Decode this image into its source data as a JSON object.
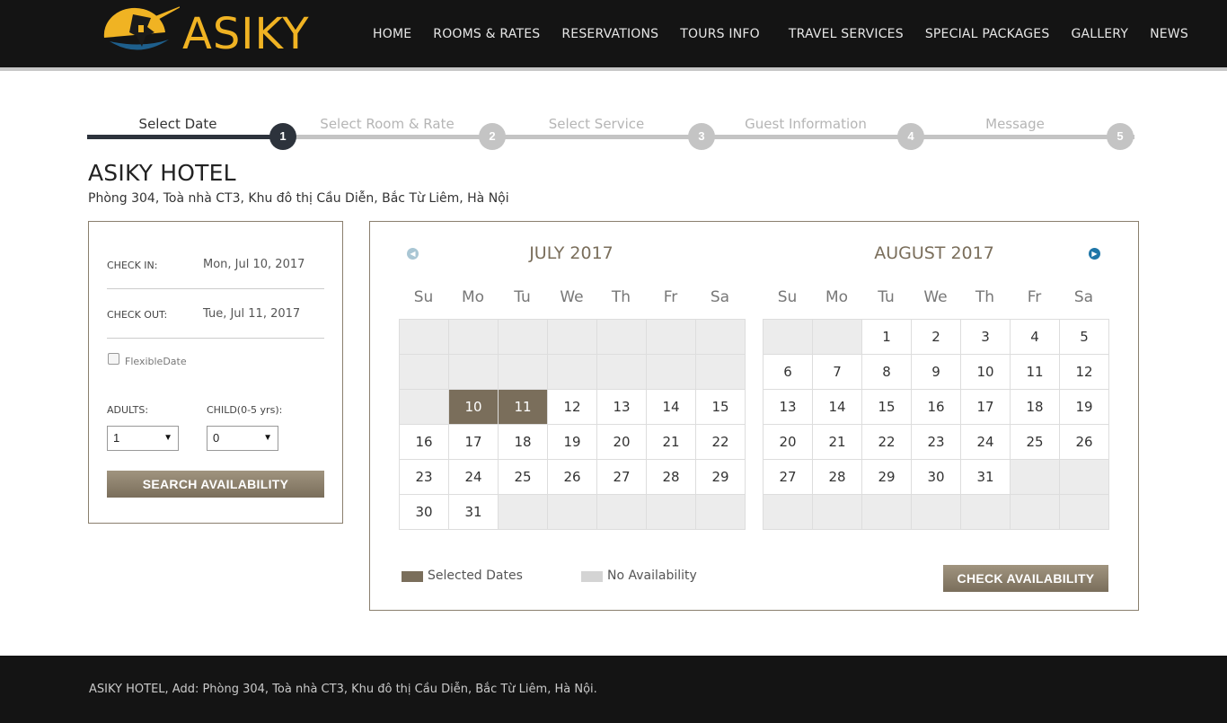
{
  "header": {
    "logo_text": "ASIKY",
    "nav": [
      "HOME",
      "ROOMS & RATES",
      "RESERVATIONS",
      "TOURS INFO",
      "TRAVEL SERVICES",
      "SPECIAL PACKAGES",
      "GALLERY",
      "NEWS"
    ]
  },
  "steps": [
    {
      "label": "Select Date",
      "number": "1",
      "active": true
    },
    {
      "label": "Select Room & Rate",
      "number": "2",
      "active": false
    },
    {
      "label": "Select Service",
      "number": "3",
      "active": false
    },
    {
      "label": "Guest Information",
      "number": "4",
      "active": false
    },
    {
      "label": "Message",
      "number": "5",
      "active": false
    }
  ],
  "hotel": {
    "name": "ASIKY HOTEL",
    "address": "Phòng 304, Toà nhà CT3, Khu đô thị Cầu Diễn, Bắc Từ Liêm, Hà Nội"
  },
  "search": {
    "check_in_label": "CHECK IN:",
    "check_in_value": "Mon, Jul 10, 2017",
    "check_out_label": "CHECK OUT:",
    "check_out_value": "Tue, Jul 11, 2017",
    "flexible_label": "FlexibleDate",
    "adults_label": "ADULTS:",
    "adults_value": "1",
    "child_label": "CHILD(0-5 yrs):",
    "child_value": "0",
    "button": "SEARCH AVAILABILITY"
  },
  "calendar": {
    "dow": [
      "Su",
      "Mo",
      "Tu",
      "We",
      "Th",
      "Fr",
      "Sa"
    ],
    "months": [
      {
        "title": "JULY 2017",
        "cells": [
          "",
          "",
          "",
          "",
          "",
          "",
          "",
          "",
          "",
          "",
          "",
          "",
          "",
          "",
          "",
          "10",
          "11",
          "12",
          "13",
          "14",
          "15",
          "16",
          "17",
          "18",
          "19",
          "20",
          "21",
          "22",
          "23",
          "24",
          "25",
          "26",
          "27",
          "28",
          "29",
          "30",
          "31",
          "",
          "",
          "",
          "",
          ""
        ],
        "selected": [
          "10",
          "11"
        ]
      },
      {
        "title": "AUGUST 2017",
        "cells": [
          "",
          "",
          "1",
          "2",
          "3",
          "4",
          "5",
          "6",
          "7",
          "8",
          "9",
          "10",
          "11",
          "12",
          "13",
          "14",
          "15",
          "16",
          "17",
          "18",
          "19",
          "20",
          "21",
          "22",
          "23",
          "24",
          "25",
          "26",
          "27",
          "28",
          "29",
          "30",
          "31",
          "",
          "",
          "",
          "",
          "",
          "",
          "",
          "",
          ""
        ],
        "selected": []
      }
    ],
    "legend_selected": "Selected Dates",
    "legend_none": "No Availability",
    "check_button": "CHECK AVAILABILITY",
    "colors": {
      "selected": "#7a6e5b",
      "unavailable": "#d4d4d4",
      "nav_prev": "#a9c6d4",
      "nav_next": "#1e76a8"
    }
  },
  "footer": {
    "text": "ASIKY HOTEL, Add: Phòng 304, Toà nhà CT3, Khu đô thị Cầu Diễn, Bắc Từ Liêm, Hà Nội."
  }
}
